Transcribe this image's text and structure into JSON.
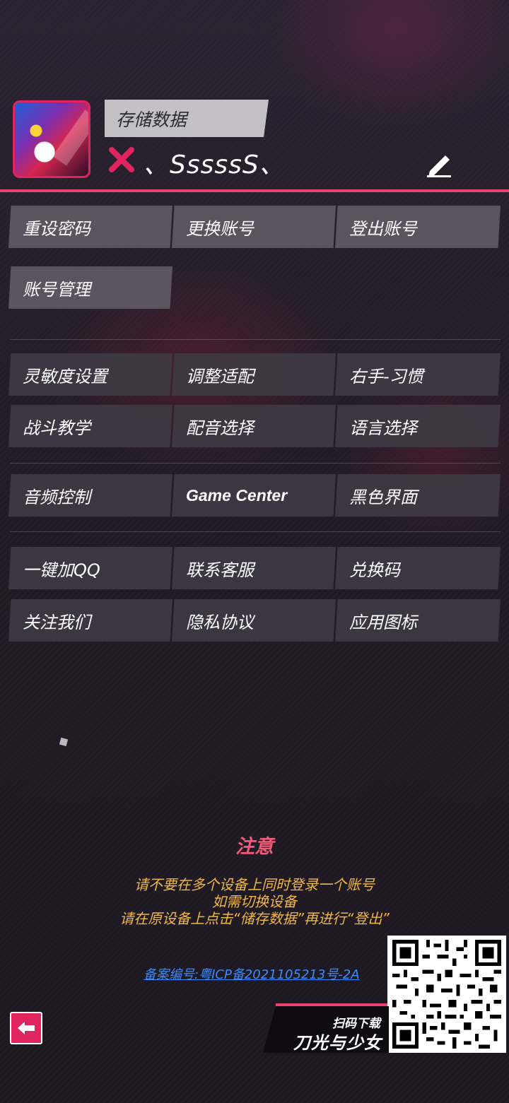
{
  "profile": {
    "save_label": "存储数据",
    "username": "、SssssS、"
  },
  "account_buttons": [
    "重设密码",
    "更换账号",
    "登出账号",
    "账号管理"
  ],
  "settings_buttons": [
    "灵敏度设置",
    "调整适配",
    "右手-习惯",
    "战斗教学",
    "配音选择",
    "语言选择"
  ],
  "system_buttons": [
    "音频控制",
    "Game Center",
    "黑色界面"
  ],
  "social_buttons": [
    "一键加QQ",
    "联系客服",
    "兑换码",
    "关注我们",
    "隐私协议",
    "应用图标"
  ],
  "notice": {
    "title": "注意",
    "lines": [
      "请不要在多个设备上同时登录一个账号",
      "如需切换设备",
      "请在原设备上点击“储存数据”再进行“登出”"
    ]
  },
  "icp": "备案编号:粤ICP备2021105213号-2A",
  "qr": {
    "scan_label": "扫码下载",
    "game_name": "刀光与少女"
  },
  "colors": {
    "accent": "#e9416c",
    "notice_text": "#f0b846",
    "link": "#3b8bff"
  }
}
